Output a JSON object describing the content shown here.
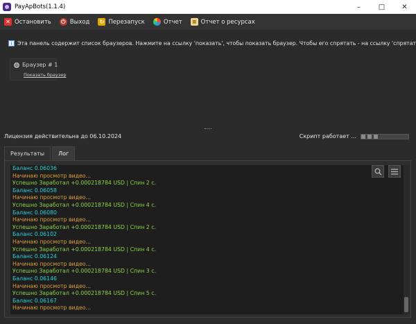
{
  "window": {
    "title": "PayApBots(1.1.4)"
  },
  "toolbar": {
    "stop_label": "Остановить",
    "exit_label": "Выход",
    "restart_label": "Перезапуск",
    "report_label": "Отчет",
    "resource_report_label": "Отчет о ресурсах"
  },
  "info": {
    "text": "Эта панель содержит список браузеров. Нажмите на ссылку 'показать', чтобы показать браузер. Чтобы его спрятать - на ссылку 'спрятать'."
  },
  "browser_card": {
    "title": "Браузер # 1",
    "link": "Показать браузер"
  },
  "license": {
    "text": "Лицензия действительна до 06.10.2024"
  },
  "status": {
    "text": "Скрипт работает ...",
    "progress": 0.4
  },
  "tabs": [
    {
      "label": "Результаты",
      "active": false
    },
    {
      "label": "Лог",
      "active": true
    }
  ],
  "log": [
    {
      "text": "Баланс 0.06036",
      "color": "#28d2d8"
    },
    {
      "text": "Начинаю просмотр видео...",
      "color": "#e0a035"
    },
    {
      "text": "Успешно Заработал +0.000218784 USD | Спин 2 с.",
      "color": "#8fd24a"
    },
    {
      "text": "Баланс 0.06058",
      "color": "#28d2d8"
    },
    {
      "text": "Начинаю просмотр видео...",
      "color": "#e0a035"
    },
    {
      "text": "Успешно Заработал +0.000218784 USD | Спин 4 с.",
      "color": "#8fd24a"
    },
    {
      "text": "Баланс 0.06080",
      "color": "#28d2d8"
    },
    {
      "text": "Начинаю просмотр видео...",
      "color": "#e0a035"
    },
    {
      "text": "Успешно Заработал +0.000218784 USD | Спин 2 с.",
      "color": "#8fd24a"
    },
    {
      "text": "Баланс 0.06102",
      "color": "#28d2d8"
    },
    {
      "text": "Начинаю просмотр видео...",
      "color": "#e0a035"
    },
    {
      "text": "Успешно Заработал +0.000218784 USD | Спин 4 с.",
      "color": "#8fd24a"
    },
    {
      "text": "Баланс 0.06124",
      "color": "#28d2d8"
    },
    {
      "text": "Начинаю просмотр видео...",
      "color": "#e0a035"
    },
    {
      "text": "Успешно Заработал +0.000218784 USD | Спин 3 с.",
      "color": "#8fd24a"
    },
    {
      "text": "Баланс 0.06146",
      "color": "#28d2d8"
    },
    {
      "text": "Начинаю просмотр видео...",
      "color": "#e0a035"
    },
    {
      "text": "Успешно Заработал +0.000218784 USD | Спин 5 с.",
      "color": "#8fd24a"
    },
    {
      "text": "Баланс 0.06167",
      "color": "#28d2d8"
    },
    {
      "text": "Начинаю просмотр видео...",
      "color": "#e0a035"
    }
  ]
}
